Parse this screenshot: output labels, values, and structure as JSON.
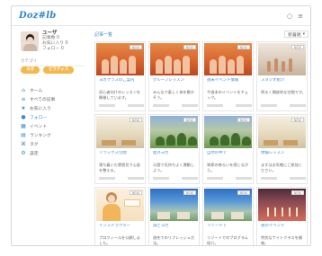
{
  "topbar": {
    "logo": "Doz#lb",
    "right_left": "○",
    "right_right": "≡"
  },
  "sidebar": {
    "user": {
      "name": "ユーザ",
      "line1": "記事数 0",
      "line2": "お気に入り 0",
      "line3": "フォロー 0"
    },
    "pill_title": "カテゴリ",
    "pills": [
      "ヨガ",
      "ピラティス"
    ],
    "nav": [
      {
        "icon": "home-icon",
        "label": "ホーム"
      },
      {
        "icon": "list-icon",
        "label": "すべての記事"
      },
      {
        "icon": "star-icon",
        "label": "お気に入り"
      },
      {
        "icon": "pin-icon",
        "label": "フォロー"
      },
      {
        "icon": "calendar-icon",
        "label": "イベント"
      },
      {
        "icon": "chart-icon",
        "label": "ランキング"
      },
      {
        "icon": "tag-icon",
        "label": "タグ"
      },
      {
        "icon": "gear-icon",
        "label": "設定"
      }
    ]
  },
  "main": {
    "header_left": "記事一覧",
    "sort_label": "新着順",
    "cards": [
      {
        "thumb": "gym",
        "badge": "NEW",
        "title": "ヨガクラスのご案内",
        "desc": "初心者向けのレッスンを開催しています。",
        "foot_left": "",
        "foot_right": ""
      },
      {
        "thumb": "gym",
        "badge": "NEW",
        "title": "グループレッスン",
        "desc": "みんなで楽しく体を動かそう。",
        "foot_left": "",
        "foot_right": ""
      },
      {
        "thumb": "gym",
        "badge": "NEW",
        "title": "週末イベント情報",
        "desc": "今週末のイベントをチェック。",
        "foot_left": "",
        "foot_right": ""
      },
      {
        "thumb": "studio",
        "badge": "NEW",
        "title": "スタジオ紹介",
        "desc": "明るく開放的な空間です。",
        "foot_left": "",
        "foot_right": ""
      },
      {
        "thumb": "room",
        "badge": "NEW",
        "title": "リラックス空間",
        "desc": "落ち着いた雰囲気で心身を整える。",
        "foot_left": "",
        "foot_right": ""
      },
      {
        "thumb": "park",
        "badge": "NEW",
        "title": "屋外ヨガ",
        "desc": "公園で気持ちよく運動しよう。",
        "foot_left": "",
        "foot_right": ""
      },
      {
        "thumb": "park",
        "badge": "NEW",
        "title": "自然の中で",
        "desc": "季節の移ろいを感じながら。",
        "foot_left": "",
        "foot_right": ""
      },
      {
        "thumb": "room",
        "badge": "NEW",
        "title": "体験レッスン",
        "desc": "まずはお気軽にご参加ください。",
        "foot_left": "",
        "foot_right": ""
      },
      {
        "thumb": "woman",
        "badge": "NEW",
        "title": "インストラクター",
        "desc": "プロフィールを公開しました。",
        "foot_left": "",
        "foot_right": ""
      },
      {
        "thumb": "sky",
        "badge": "NEW",
        "title": "旅とヨガ",
        "desc": "旅先でのリフレッシュ方法。",
        "foot_left": "",
        "foot_right": ""
      },
      {
        "thumb": "sky",
        "badge": "NEW",
        "title": "リゾートで",
        "desc": "リゾートでのプログラム紹介。",
        "foot_left": "",
        "foot_right": ""
      },
      {
        "thumb": "hall",
        "badge": "NEW",
        "title": "夜のイベント",
        "desc": "特別なナイトクラスを開催。",
        "foot_left": "",
        "foot_right": ""
      }
    ]
  }
}
